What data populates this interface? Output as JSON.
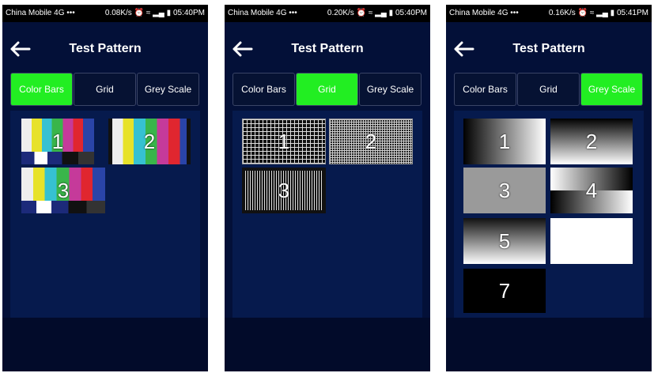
{
  "screens": [
    {
      "status": {
        "carrier": "China Mobile 4G •••",
        "speed": "0.08K/s",
        "time": "05:40PM"
      },
      "header": {
        "title": "Test Pattern"
      },
      "tabs": [
        {
          "label": "Color Bars",
          "active": true
        },
        {
          "label": "Grid",
          "active": false
        },
        {
          "label": "Grey Scale",
          "active": false
        }
      ],
      "thumbnails": [
        "1",
        "2",
        "3"
      ]
    },
    {
      "status": {
        "carrier": "China Mobile 4G •••",
        "speed": "0.20K/s",
        "time": "05:40PM"
      },
      "header": {
        "title": "Test Pattern"
      },
      "tabs": [
        {
          "label": "Color Bars",
          "active": false
        },
        {
          "label": "Grid",
          "active": true
        },
        {
          "label": "Grey Scale",
          "active": false
        }
      ],
      "thumbnails": [
        "1",
        "2",
        "3"
      ]
    },
    {
      "status": {
        "carrier": "China Mobile 4G •••",
        "speed": "0.16K/s",
        "time": "05:41PM"
      },
      "header": {
        "title": "Test Pattern"
      },
      "tabs": [
        {
          "label": "Color Bars",
          "active": false
        },
        {
          "label": "Grid",
          "active": false
        },
        {
          "label": "Grey Scale",
          "active": true
        }
      ],
      "thumbnails": [
        "1",
        "2",
        "3",
        "4",
        "5",
        "7"
      ]
    }
  ],
  "icons": {
    "back": "arrow-left-icon",
    "alarm": "alarm-icon",
    "wifi": "wifi-icon",
    "signal": "signal-icon",
    "battery": "battery-icon"
  },
  "colors": {
    "background": "#031038",
    "content": "#061a4d",
    "active_tab": "#22ee22",
    "text": "#ffffff"
  }
}
